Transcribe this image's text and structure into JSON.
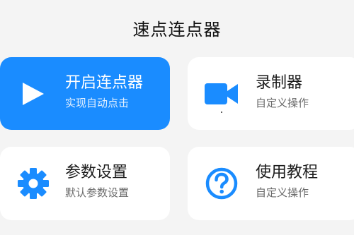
{
  "app": {
    "title": "速点连点器"
  },
  "colors": {
    "accent": "#1a8cff",
    "background": "#f4f4f4",
    "card": "#ffffff"
  },
  "cards": [
    {
      "title": "开启连点器",
      "subtitle": "实现自动点击",
      "icon": "play-icon",
      "active": true
    },
    {
      "title": "录制器",
      "subtitle": "自定义操作",
      "icon": "video-camera-icon",
      "active": false
    },
    {
      "title": "参数设置",
      "subtitle": "默认参数设置",
      "icon": "gear-icon",
      "active": false
    },
    {
      "title": "使用教程",
      "subtitle": "自定义操作",
      "icon": "question-circle-icon",
      "active": false
    }
  ]
}
